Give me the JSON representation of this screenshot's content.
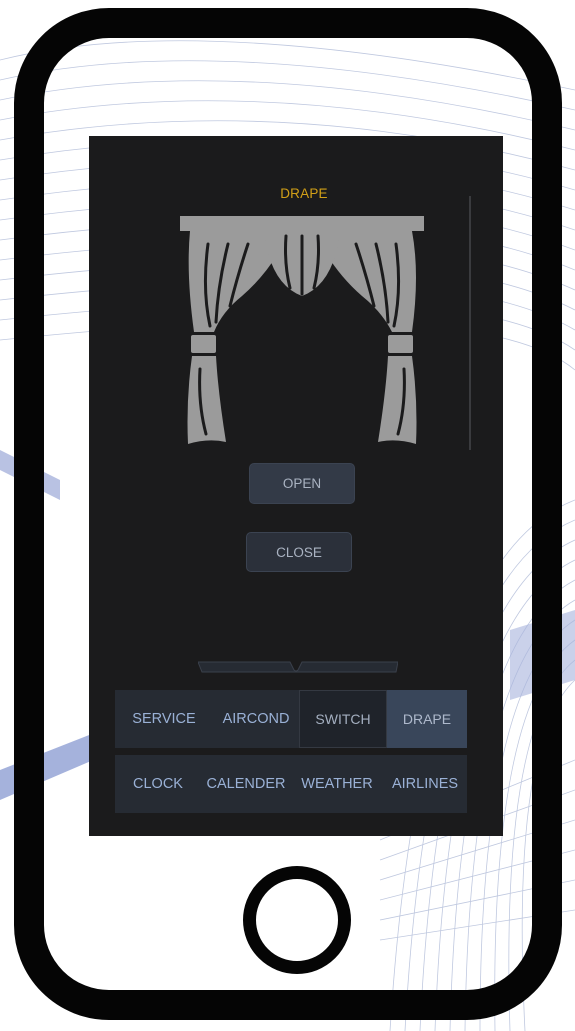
{
  "screen": {
    "title": "DRAPE",
    "curtain_icon": "curtain-icon",
    "buttons": {
      "open": "OPEN",
      "close": "CLOSE"
    }
  },
  "nav": {
    "row1": [
      "SERVICE",
      "AIRCOND",
      "SWITCH",
      "DRAPE"
    ],
    "row2": [
      "CLOCK",
      "CALENDER",
      "WEATHER",
      "AIRLINES"
    ],
    "active": "DRAPE"
  },
  "colors": {
    "title": "#d2a017",
    "screen_bg": "#1b1b1c",
    "nav_bg": "#262b33",
    "nav_text": "#9ab1d6",
    "active_tab": "#39465a",
    "curtain": "#9b9b9b"
  }
}
